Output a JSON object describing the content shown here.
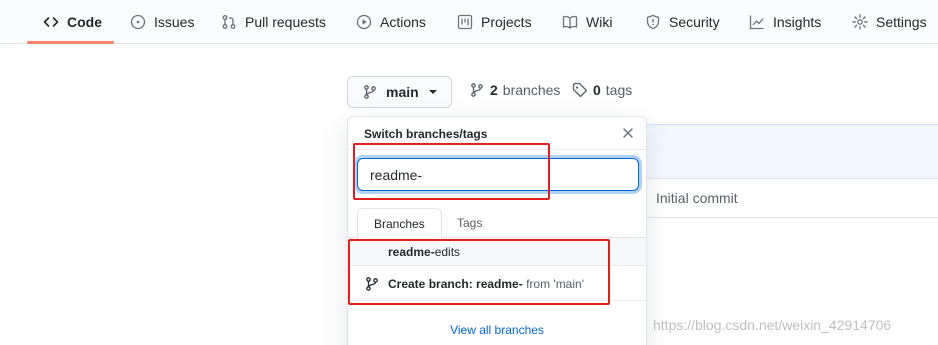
{
  "nav": {
    "items": [
      {
        "label": "Code",
        "icon": "code-icon",
        "selected": true
      },
      {
        "label": "Issues",
        "icon": "issue-icon"
      },
      {
        "label": "Pull requests",
        "icon": "pull-request-icon"
      },
      {
        "label": "Actions",
        "icon": "play-icon"
      },
      {
        "label": "Projects",
        "icon": "project-icon"
      },
      {
        "label": "Wiki",
        "icon": "book-icon"
      },
      {
        "label": "Security",
        "icon": "shield-icon"
      },
      {
        "label": "Insights",
        "icon": "graph-icon"
      },
      {
        "label": "Settings",
        "icon": "gear-icon"
      }
    ],
    "accent": "#f9826c"
  },
  "branch_button": {
    "label": "main"
  },
  "branches_link": {
    "count": "2",
    "label": "branches"
  },
  "tags_link": {
    "count": "0",
    "label": "tags"
  },
  "dropdown": {
    "title": "Switch branches/tags",
    "filter_value": "readme-",
    "tabs": [
      "Branches",
      "Tags"
    ],
    "match_item": {
      "bold": "readme-",
      "rest": "edits"
    },
    "create_item": {
      "prefix": "Create branch: ",
      "name": "readme-",
      "suffix": "from 'main'"
    },
    "view_all": "View all branches"
  },
  "file_row": {
    "commit_message": "Initial commit"
  },
  "watermark": "https://blog.csdn.net/weixin_42914706",
  "colors": {
    "highlight": "#e02020",
    "link": "#0366d6",
    "focus": "#0366d6"
  }
}
